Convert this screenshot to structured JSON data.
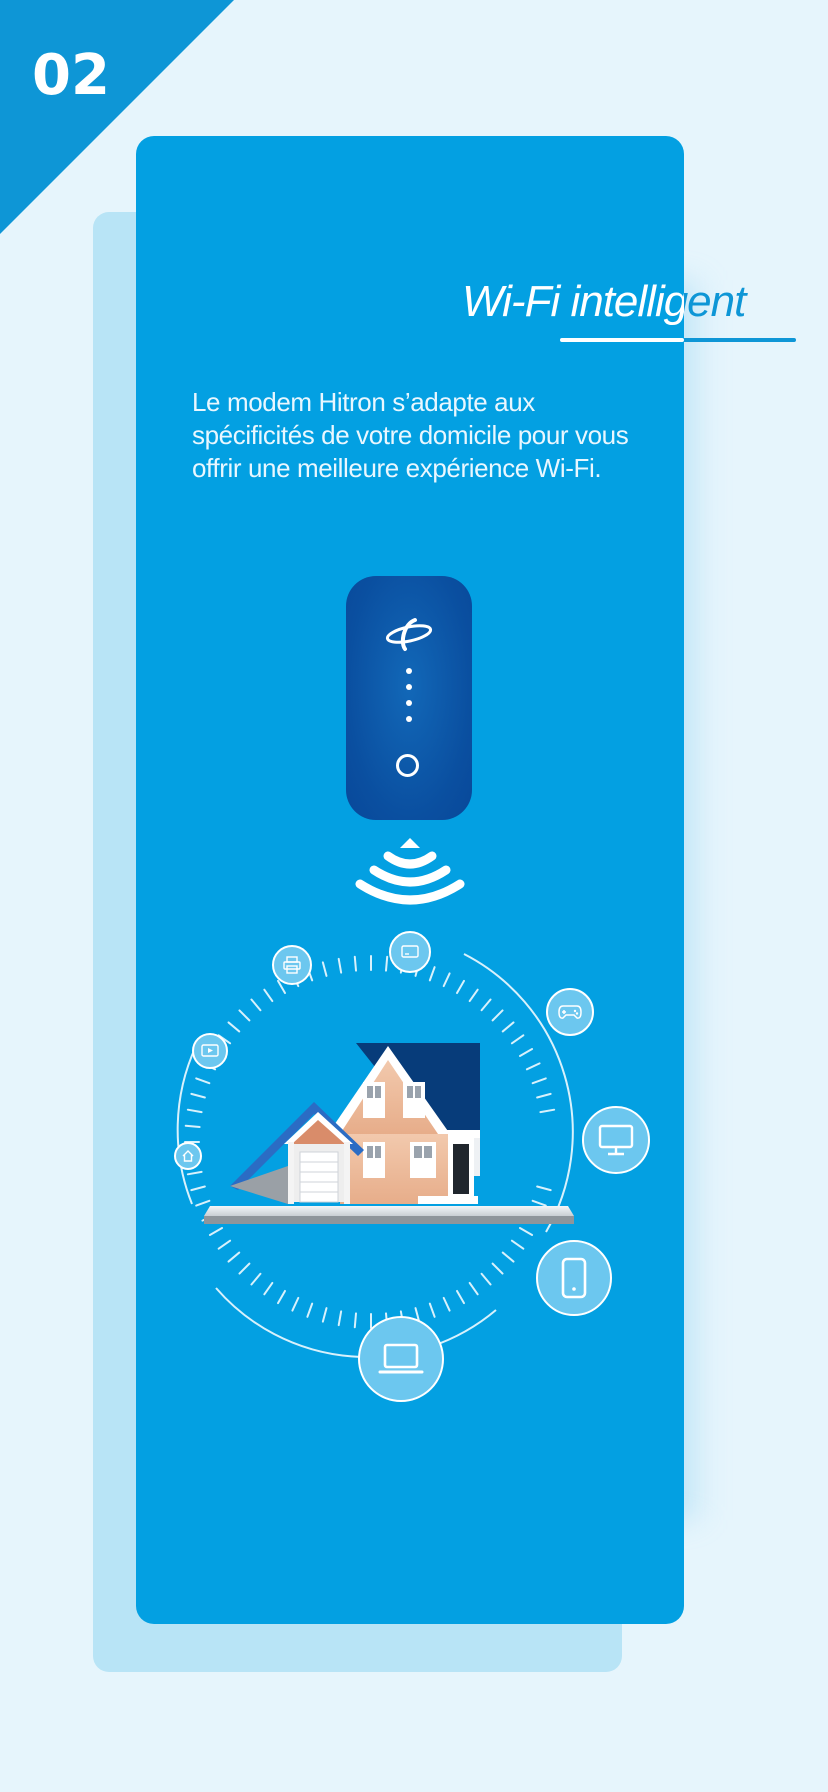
{
  "step": {
    "number": "02"
  },
  "card": {
    "title": "Wi-Fi intelligent",
    "description": "Le modem Hitron s’adapte aux spécificités de votre domicile pour vous offrir une meilleure expérience Wi-Fi."
  },
  "illustration": {
    "modem_icons": [
      "hitron-logo-icon",
      "status-dots-icon",
      "power-ring-icon"
    ],
    "signal_icon": "wifi-signal-icon",
    "devices": [
      "home-icon",
      "tv-play-icon",
      "printer-icon",
      "monitor-icon",
      "gamepad-icon",
      "desktop-icon",
      "smartphone-icon",
      "laptop-icon"
    ]
  },
  "colors": {
    "background": "#e6f5fc",
    "accent": "#0e96d6",
    "card": "#03a0e2",
    "back_card": "#b8e4f6",
    "modem": "#0a4fa0",
    "device_bubble": "#6cc7ef"
  }
}
